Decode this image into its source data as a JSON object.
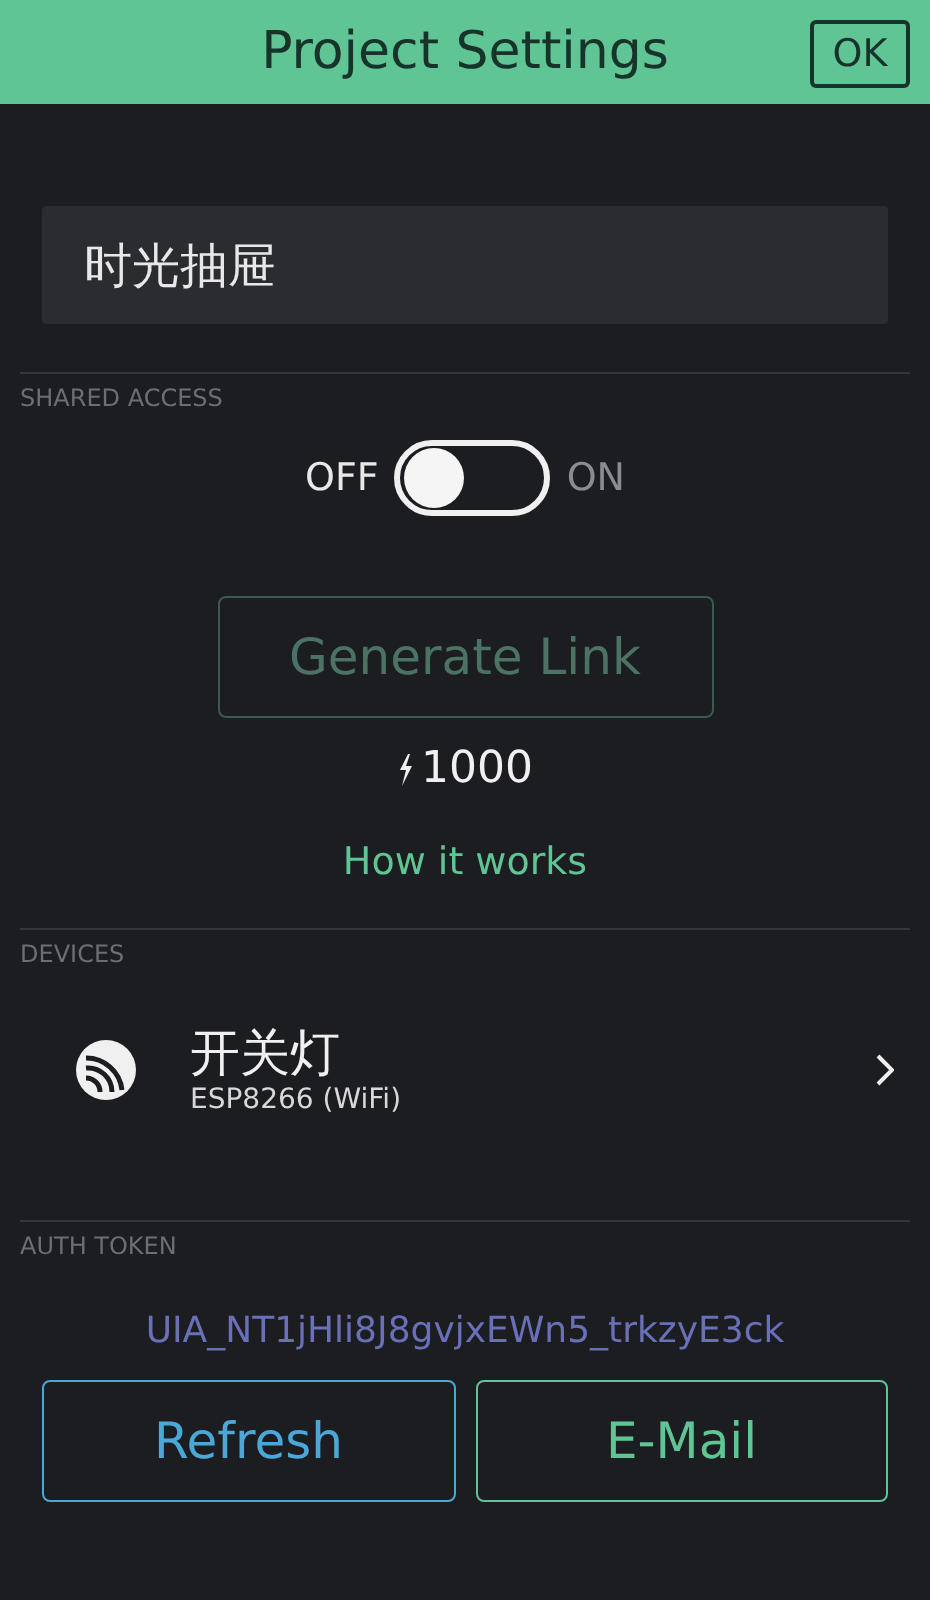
{
  "header": {
    "title": "Project Settings",
    "ok_button": "OK"
  },
  "project_name": {
    "value": "时光抽屉"
  },
  "shared_access": {
    "heading": "SHARED ACCESS",
    "off_label": "OFF",
    "on_label": "ON",
    "on": false,
    "generate_button": {
      "label": "Generate Link",
      "disabled": true
    },
    "energy": "1000",
    "help_link": "How it works"
  },
  "devices": {
    "heading": "DEVICES",
    "items": [
      {
        "name": "开关灯",
        "model": "ESP8266 (WiFi)"
      }
    ]
  },
  "auth_token": {
    "heading": "AUTH TOKEN",
    "token": "UIA_NT1jHli8J8gvjxEWn5_trkzyE3ck",
    "buttons": [
      {
        "label": "Refresh",
        "kind": "refresh"
      },
      {
        "label": "E-Mail",
        "kind": "email"
      }
    ]
  }
}
